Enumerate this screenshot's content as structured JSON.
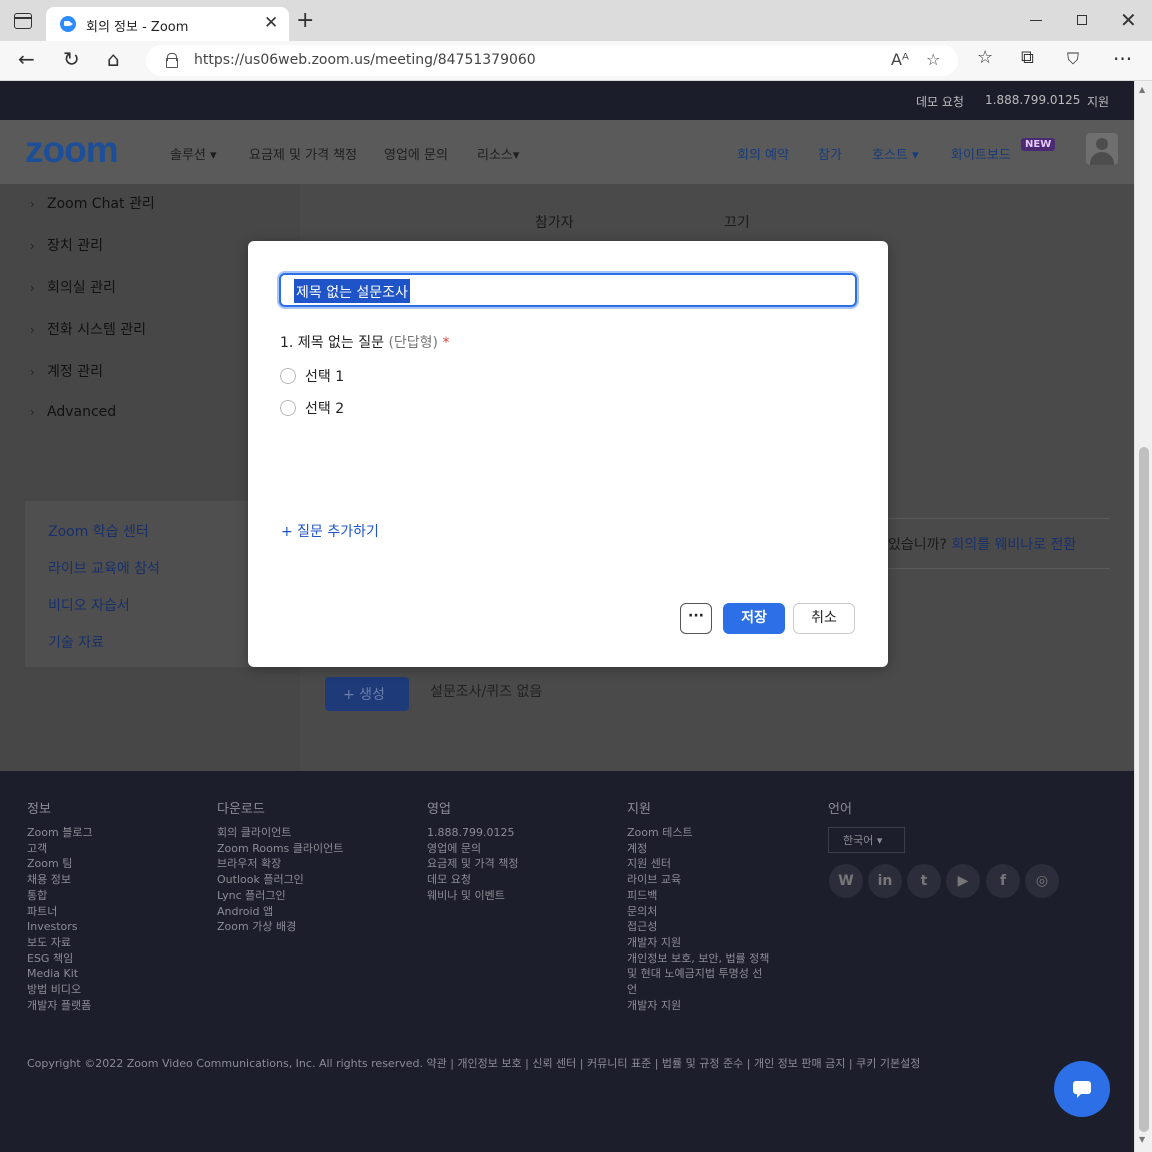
{
  "browser": {
    "tab_title": "회의 정보 - Zoom",
    "url": "https://us06web.zoom.us/meeting/84751379060"
  },
  "topstrip": {
    "demo": "데모 요청",
    "phone": "1.888.799.0125",
    "support": "지원"
  },
  "nav": {
    "logo": "zoom",
    "left": [
      "솔루션 ▾",
      "요금제 및 가격 책정",
      "영업에 문의",
      "리소스▾"
    ],
    "right": [
      "회의 예약",
      "참가",
      "호스트 ▾",
      "화이트보드"
    ],
    "new_badge": "NEW"
  },
  "sidebar": {
    "items": [
      "Zoom Chat 관리",
      "장치 관리",
      "회의실 관리",
      "전화 시스템 관리",
      "계정 관리",
      "Advanced"
    ],
    "learn": [
      "Zoom 학습 센터",
      "라이브 교육에 참석",
      "비디오 자습서",
      "기술 자료"
    ]
  },
  "content": {
    "row_participant": "참가자",
    "row_participant_val": "끄기",
    "webinar_prompt": "있습니까?",
    "webinar_link": "회의를 웨비나로 전환",
    "create_label": "+ 생성",
    "no_poll": "설문조사/퀴즈 없음"
  },
  "modal": {
    "title_value": "제목 없는 설문조사",
    "question": "1. 제목 없는 질문",
    "question_type": "(단답형)",
    "required_mark": "*",
    "choices": [
      "선택 1",
      "선택 2"
    ],
    "add_question": "+ 질문 추가하기",
    "more": "···",
    "save": "저장",
    "cancel": "취소"
  },
  "footer": {
    "headings": [
      "정보",
      "다운로드",
      "영업",
      "지원",
      "언어"
    ],
    "col_info": [
      "Zoom 블로그",
      "고객",
      "Zoom 팀",
      "채용 정보",
      "통합",
      "파트너",
      "Investors",
      "보도 자료",
      "ESG 책임",
      "Media Kit",
      "방법 비디오",
      "개발자 플랫폼"
    ],
    "col_download": [
      "회의 클라이언트",
      "Zoom Rooms 클라이언트",
      "브라우저 확장",
      "Outlook 플러그인",
      "Lync 플러그인",
      "Android 앱",
      "Zoom 가상 배경"
    ],
    "col_sales": [
      "1.888.799.0125",
      "영업에 문의",
      "요금제 및 가격 책정",
      "데모 요청",
      "웨비나 및 이벤트"
    ],
    "col_support": [
      "Zoom 테스트",
      "계정",
      "지원 센터",
      "라이브 교육",
      "피드백",
      "문의처",
      "접근성",
      "개발자 지원",
      "개인정보 보호, 보안, 법률 정책",
      "및 현대 노예금지법 투명성 선",
      "언",
      "개발자 지원"
    ],
    "language": "한국어 ▾",
    "social": [
      "W",
      "in",
      "t",
      "▶",
      "f",
      "◎"
    ],
    "copyright": "Copyright ©2022 Zoom Video Communications, Inc. All rights reserved.  약관  |  개인정보 보호  |  신뢰 센터  |  커뮤니티 표준  |  법률 및 규정 준수  |  개인 정보 판매 금지  |  쿠키 기본설정"
  }
}
